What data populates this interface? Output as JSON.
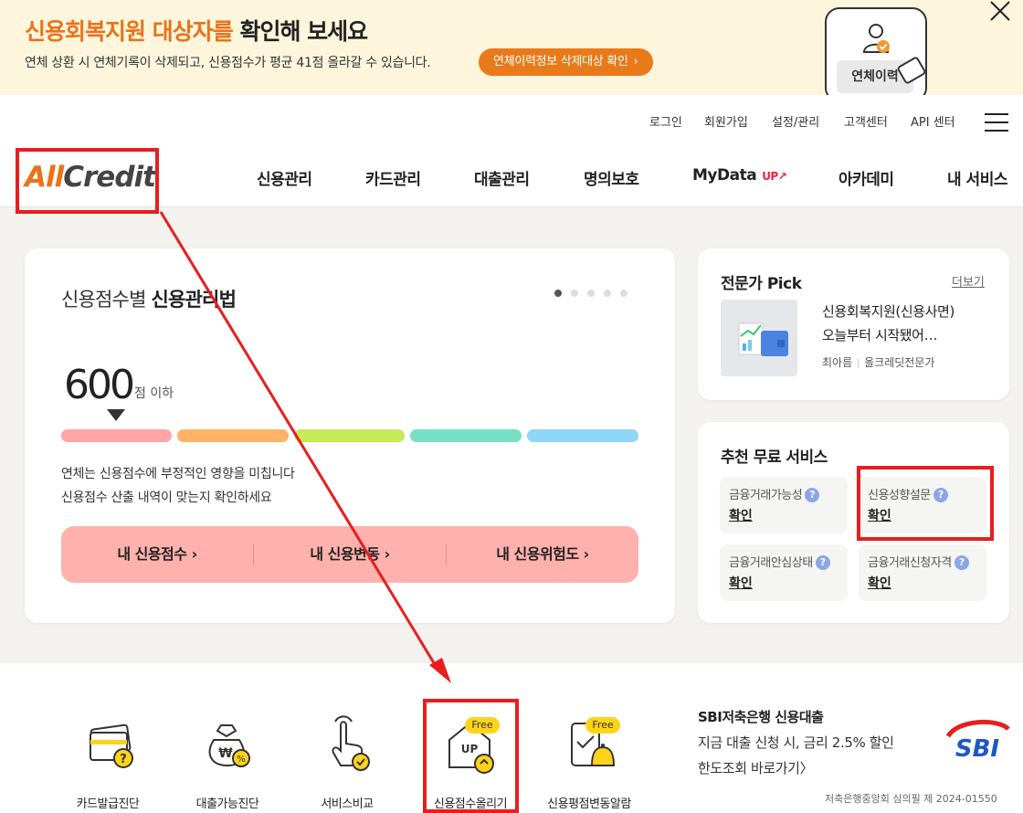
{
  "banner": {
    "title_highlight": "신용회복지원 대상자를",
    "title_rest": "확인해 보세요",
    "desc": "연체 상환 시 연체기록이 삭제되고, 신용점수가 평균 41점 올라갈 수 있습니다.",
    "cta": "연체이력정보 삭제대상 확인",
    "phone_label": "연체이력"
  },
  "util_nav": [
    "로그인",
    "회원가입",
    "설정/관리",
    "고객센터",
    "API 센터"
  ],
  "logo": {
    "part1": "All",
    "part2": "Credit"
  },
  "main_nav": [
    "신용관리",
    "카드관리",
    "대출관리",
    "명의보호",
    "MyData",
    "아카데미",
    "내 서비스"
  ],
  "mydata_badge": "UP",
  "credit_guide": {
    "title_normal": "신용점수별",
    "title_bold": "신용관리법",
    "score": "600",
    "score_unit": "점 이하",
    "line1": "연체는 신용점수에 부정적인 영향을 미칩니다",
    "line2": "신용점수 산출 내역이 맞는지 확인하세요",
    "bar_colors": [
      "#ffa5a5",
      "#ffb366",
      "#c5ea5a",
      "#77e0c4",
      "#8fd6f7"
    ],
    "actions": [
      "내 신용점수 ›",
      "내 신용변동 ›",
      "내 신용위험도 ›"
    ]
  },
  "expert_pick": {
    "title": "전문가 Pick",
    "more": "더보기",
    "line1": "신용회복지원(신용사면)",
    "line2": "오늘부터 시작됐어…",
    "author": "최아름",
    "author_role": "올크레딧전문가"
  },
  "free_services": {
    "title": "추천 무료 서비스",
    "items": [
      {
        "name": "금융거래가능성",
        "action": "확인"
      },
      {
        "name": "신용성향설문",
        "action": "확인"
      },
      {
        "name": "금융거래안심상태",
        "action": "확인"
      },
      {
        "name": "금융거래신청자격",
        "action": "확인"
      }
    ]
  },
  "quick_icons": [
    {
      "label": "카드발급진단",
      "icon": "card-diagnosis-icon"
    },
    {
      "label": "대출가능진단",
      "icon": "loan-bag-icon"
    },
    {
      "label": "서비스비교",
      "icon": "hand-tap-icon"
    },
    {
      "label": "신용점수올리기",
      "icon": "score-up-house-icon",
      "tag": "Free"
    },
    {
      "label": "신용평점변동알람",
      "icon": "phone-bell-icon",
      "tag": "Free"
    }
  ],
  "sbi_ad": {
    "title": "SBI저축은행 신용대출",
    "line1": "지금 대출 신청 시, 금리 2.5% 할인",
    "line2": "한도조회 바로가기〉",
    "notice": "저축은행중앙회 심의필 제 2024-01550",
    "logo": "SBI"
  },
  "colors": {
    "accent": "#e8731a",
    "annotation": "#e81e1e",
    "cta_pink": "#ffb1ad"
  }
}
